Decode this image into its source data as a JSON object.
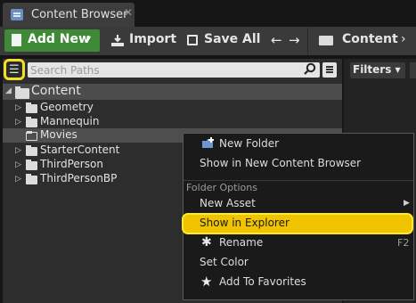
{
  "window": {
    "tab_title": "Content Browser",
    "tab_close": "✕"
  },
  "toolbar": {
    "add_new_label": "Add New",
    "add_new_caret": "▾",
    "import_label": "Import",
    "save_all_label": "Save All",
    "back_arrow": "←",
    "forward_arrow": "→",
    "path_separator": "▸",
    "breadcrumb_label": "Content",
    "breadcrumb_chevron": "›"
  },
  "search": {
    "placeholder": "Search Paths"
  },
  "filters": {
    "label": "Filters ▾"
  },
  "tree": {
    "root": "Content",
    "children": [
      "Geometry",
      "Mannequin",
      "Movies",
      "StarterContent",
      "ThirdPerson",
      "ThirdPersonBP"
    ],
    "selected": "Movies"
  },
  "context_menu": {
    "new_folder": "New Folder",
    "show_in_new_browser": "Show in New Content Browser",
    "folder_options_header": "Folder Options",
    "new_asset": "New Asset",
    "new_asset_arrow": "▶",
    "show_in_explorer": "Show in Explorer",
    "rename": "Rename",
    "rename_shortcut": "F2",
    "set_color": "Set Color",
    "add_to_favorites": "Add To Favorites"
  },
  "colors": {
    "add_new_green": "#3f8a36",
    "highlight_yellow": "#f0c400",
    "panel_bg": "#2d2d2d",
    "menu_bg": "#1a1a1a"
  },
  "icons": {
    "tab": "content-browser-icon",
    "add_new": "new-document-icon",
    "import": "import-icon",
    "save_all": "save-icon",
    "sidebar_toggle": "sidebar-toggle-icon",
    "search": "search-icon",
    "new_folder": "new-folder-icon",
    "rename": "rename-icon",
    "favorites": "star-icon"
  }
}
